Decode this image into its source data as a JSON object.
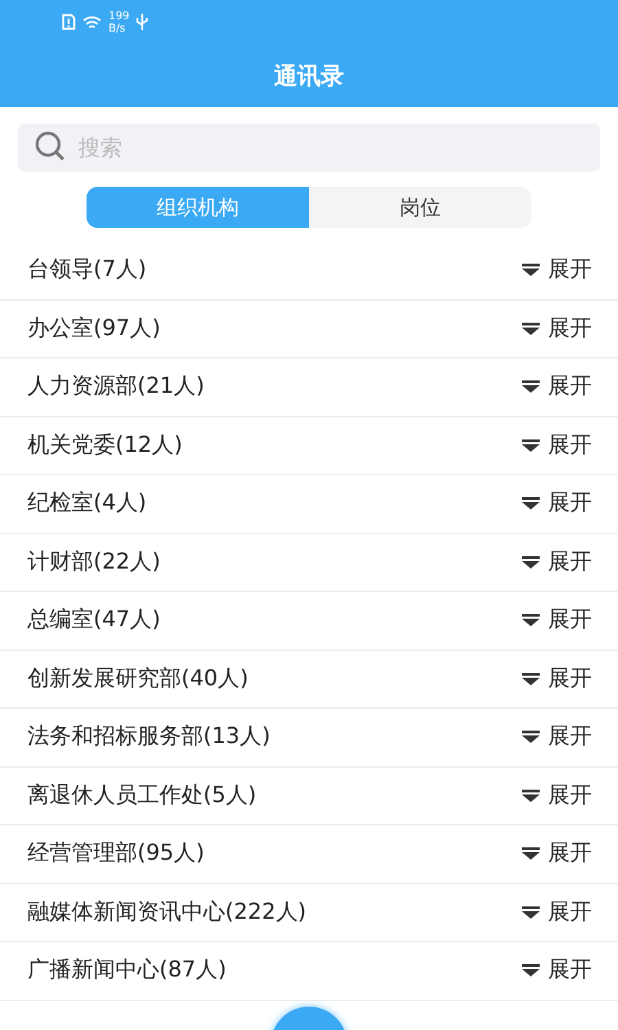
{
  "status_bar": {
    "network_speed": "199",
    "speed_unit": "B/s"
  },
  "header": {
    "title": "通讯录"
  },
  "search": {
    "placeholder": "搜索"
  },
  "tabs": [
    {
      "label": "组织机构",
      "selected": true
    },
    {
      "label": "岗位",
      "selected": false
    }
  ],
  "departments": [
    {
      "name": "台领导(7人)",
      "action": "展开",
      "expanded": false
    },
    {
      "name": "办公室(97人)",
      "action": "展开",
      "expanded": false
    },
    {
      "name": "人力资源部(21人)",
      "action": "展开",
      "expanded": false
    },
    {
      "name": "机关党委(12人)",
      "action": "展开",
      "expanded": false
    },
    {
      "name": "纪检室(4人)",
      "action": "展开",
      "expanded": false
    },
    {
      "name": "计财部(22人)",
      "action": "展开",
      "expanded": false
    },
    {
      "name": "总编室(47人)",
      "action": "展开",
      "expanded": false
    },
    {
      "name": "创新发展研究部(40人)",
      "action": "展开",
      "expanded": false
    },
    {
      "name": "法务和招标服务部(13人)",
      "action": "展开",
      "expanded": false
    },
    {
      "name": "离退休人员工作处(5人)",
      "action": "展开",
      "expanded": false
    },
    {
      "name": "经营管理部(95人)",
      "action": "展开",
      "expanded": false
    },
    {
      "name": "融媒体新闻资讯中心(222人)",
      "action": "展开",
      "expanded": false
    },
    {
      "name": "广播新闻中心(87人)",
      "action": "展开",
      "expanded": false
    }
  ]
}
